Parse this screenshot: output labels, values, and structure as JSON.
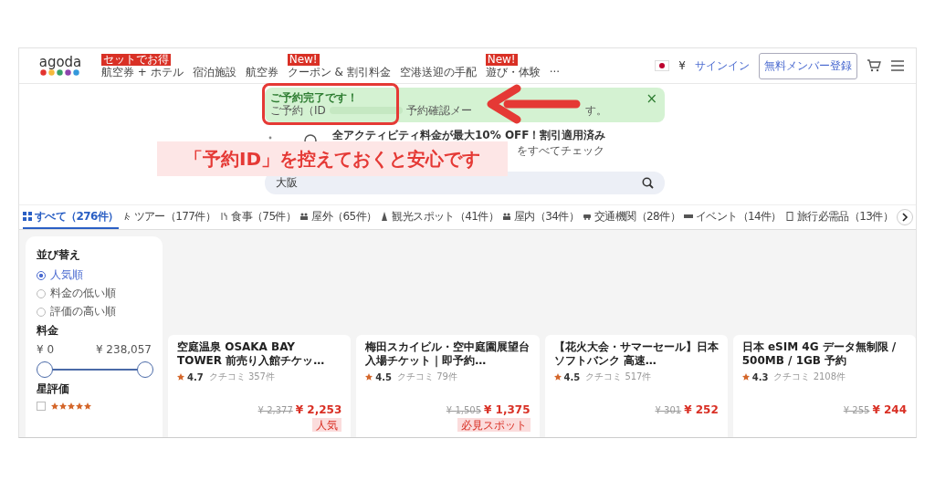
{
  "header": {
    "logo": "agoda",
    "nav": [
      {
        "label": "航空券 + ホテル",
        "badge": "セットでお得"
      },
      {
        "label": "宿泊施設"
      },
      {
        "label": "航空券"
      },
      {
        "label": "クーポン & 割引料金",
        "badge": "New!"
      },
      {
        "label": "空港送迎の手配"
      },
      {
        "label": "遊び・体験",
        "badge": "New!"
      },
      {
        "label": "···"
      }
    ],
    "currency": "¥",
    "sign_in": "サインイン",
    "register": "無料メンバー登録"
  },
  "notice": {
    "title": "ご予約完了です！",
    "line_parts": [
      "ご予約（ID",
      "予約確認メー",
      "す。"
    ],
    "close": "×"
  },
  "promo": {
    "title": "全アクティビティ料金が最大10% OFF！割引適用済み",
    "subtitle": "をすべてチェック"
  },
  "search": {
    "value": "大阪"
  },
  "tabs": [
    {
      "label": "すべて（276件）",
      "selected": true
    },
    {
      "label": "ツアー（177件）",
      "selected": false
    },
    {
      "label": "食事（75件）",
      "selected": false
    },
    {
      "label": "屋外（65件）",
      "selected": false
    },
    {
      "label": "観光スポット（41件）",
      "selected": false
    },
    {
      "label": "屋内（34件）",
      "selected": false
    },
    {
      "label": "交通機関（28件）",
      "selected": false
    },
    {
      "label": "イベント（14件）",
      "selected": false
    },
    {
      "label": "旅行必需品（13件）",
      "selected": false
    }
  ],
  "sidebar": {
    "sort_title": "並び替え",
    "sort_options": [
      {
        "label": "人気順",
        "selected": true
      },
      {
        "label": "料金の低い順",
        "selected": false
      },
      {
        "label": "評価の高い順",
        "selected": false
      }
    ],
    "price_title": "料金",
    "price_min": "¥ 0",
    "price_max": "¥ 238,057",
    "price_range": {
      "level": 1
    },
    "rating_title": "星評価",
    "rating_options": [
      {
        "stars": 5,
        "checked": false
      }
    ]
  },
  "cards": [
    {
      "title": "空庭温泉 OSAKA BAY TOWER 前売り入館チケッ…",
      "rating": "4.7",
      "reviews": "クチコミ 357件",
      "old_price": "¥ 2,377",
      "price": "¥ 2,253",
      "badge": "人気"
    },
    {
      "title": "梅田スカイビル・空中庭園展望台入場チケット｜即予約…",
      "rating": "4.5",
      "reviews": "クチコミ 79件",
      "old_price": "¥ 1,505",
      "price": "¥ 1,375",
      "badge": "必見スポット"
    },
    {
      "title": "【花火大会・サマーセール】日本ソフトバンク 高速…",
      "rating": "4.5",
      "reviews": "クチコミ 517件",
      "old_price": "¥ 301",
      "price": "¥ 252"
    },
    {
      "title": "日本 eSIM 4G データ無制限 / 500MB / 1GB 予約",
      "rating": "4.3",
      "reviews": "クチコミ 2108件",
      "old_price": "¥ 255",
      "price": "¥ 244"
    }
  ],
  "annotation": {
    "callout": "「予約ID」を控えておくと安心です"
  }
}
